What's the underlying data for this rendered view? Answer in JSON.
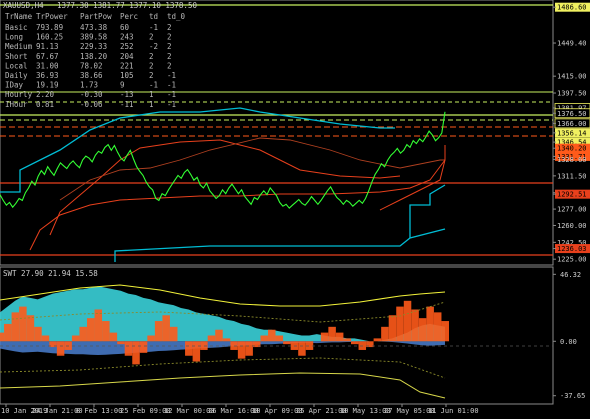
{
  "header": {
    "symbol": "XAUUSD,H4",
    "ohlc": "1377.30 1381.77 1377.10 1378.50"
  },
  "power_table": {
    "headers": [
      "TrName",
      "TrPower",
      "PartPow",
      "Perc",
      "td",
      "td_0"
    ],
    "rows": [
      [
        "Basic",
        "793.89",
        "473.38",
        "60",
        "-1",
        "2"
      ],
      [
        "Long",
        "160.25",
        "389.58",
        "243",
        "2",
        "2"
      ],
      [
        "Medium",
        "91.13",
        "229.33",
        "252",
        "-2",
        "2"
      ],
      [
        "Short",
        "67.67",
        "138.20",
        "204",
        "2",
        "2"
      ],
      [
        "Local",
        "31.00",
        "78.02",
        "221",
        "2",
        "2"
      ],
      [
        "Daily",
        "36.93",
        "38.66",
        "105",
        "2",
        "-1"
      ],
      [
        "IDay",
        "19.19",
        "1.73",
        "9",
        "-1",
        "-1"
      ],
      [
        "Hourly",
        "2.20",
        "-0.30",
        "-13",
        "1",
        "-1"
      ],
      [
        "IHour",
        "0.81",
        "-0.06",
        "-11",
        "1",
        "-1"
      ]
    ]
  },
  "indicator": {
    "label": "SWT 27.90 21.94 15.58",
    "axis_labels": [
      "46.32",
      "0.00",
      "-37.65"
    ]
  },
  "colors": {
    "background": "#000000",
    "price_line": "#33ff33",
    "trend_cyan": "#00bcd4",
    "trend_red": "#e8401c",
    "level_yellow": "#f0f060",
    "indicator_cyan": "#3ad0d8",
    "indicator_orange": "#ff5a1a",
    "indicator_blue": "#4a7fd0",
    "indicator_yellow": "#f2f23a"
  },
  "chart_data": [
    {
      "type": "line",
      "title": "XAUUSD,H4",
      "series": [
        {
          "values": [
            1292,
            1286,
            1281,
            1284,
            1279,
            1283,
            1288,
            1286,
            1294,
            1299,
            1306,
            1302,
            1311,
            1317,
            1313,
            1321,
            1316,
            1312,
            1319,
            1325,
            1322,
            1319,
            1324,
            1327,
            1323,
            1320,
            1328,
            1332,
            1330,
            1326,
            1333,
            1337,
            1335,
            1341,
            1344,
            1338,
            1343,
            1336,
            1330,
            1327,
            1333,
            1338,
            1329,
            1321,
            1316,
            1312,
            1305,
            1300,
            1297,
            1288,
            1286,
            1293,
            1291,
            1297,
            1302,
            1307,
            1312,
            1309,
            1315,
            1318,
            1313,
            1307,
            1310,
            1302,
            1299,
            1304,
            1296,
            1292,
            1288,
            1291,
            1297,
            1293,
            1299,
            1303,
            1298,
            1293,
            1297,
            1290,
            1286,
            1282,
            1289,
            1287,
            1292,
            1296,
            1292,
            1299,
            1295,
            1291,
            1284,
            1280,
            1282,
            1278,
            1281,
            1284,
            1287,
            1283,
            1281,
            1285,
            1290,
            1286,
            1282,
            1286,
            1291,
            1296,
            1300,
            1294,
            1289,
            1286,
            1282,
            1286,
            1284,
            1280,
            1283,
            1286,
            1283,
            1288,
            1296,
            1305,
            1313,
            1318,
            1324,
            1321,
            1328,
            1333,
            1336,
            1340,
            1335,
            1338,
            1344,
            1341,
            1348,
            1345,
            1350,
            1347,
            1352,
            1358,
            1354,
            1348,
            1351,
            1356,
            1378
          ]
        }
      ],
      "y_axis_labels": [
        "1486.60",
        "1449.40",
        "1415.00",
        "1397.50",
        "1381.97",
        "1376.50",
        "1366.00",
        "1356.14",
        "1346.54",
        "1340.20",
        "1331.71",
        "1328.60",
        "1311.50",
        "1294.00",
        "1292.51",
        "1277.00",
        "1260.00",
        "1242.50",
        "1236.03",
        "1225.00"
      ],
      "x_axis_labels": [
        "10 Jan 2019",
        "24 Jan 21:00",
        "8 Feb 13:00",
        "25 Feb 09:00",
        "12 Mar 00:00",
        "26 Mar 16:00",
        "10 Apr 09:00",
        "25 Apr 21:00",
        "10 May 13:00",
        "27 May 05:00",
        "11 Jun 01:00"
      ],
      "ylim": [
        1220,
        1492
      ]
    },
    {
      "type": "area",
      "title": "SWT 27.90 21.94 15.58",
      "ylim": [
        -42,
        50
      ],
      "y_axis_labels": [
        "46.32",
        "0.00",
        "-37.65"
      ],
      "series": [
        {
          "name": "cyan-envelope",
          "values": [
            20,
            24,
            28,
            31,
            30,
            29,
            31,
            33,
            34,
            35,
            36,
            36,
            37,
            38,
            37,
            36,
            35,
            33,
            32,
            30,
            29,
            27,
            26,
            25,
            23,
            22,
            20,
            19,
            18,
            17,
            15,
            14,
            12,
            11,
            9,
            8,
            8,
            7,
            6,
            5,
            4,
            4,
            5,
            4,
            3,
            3,
            2,
            2,
            1,
            0,
            0,
            1,
            2,
            4,
            6,
            9,
            11,
            12,
            11,
            10
          ]
        },
        {
          "name": "orange-oscillator",
          "values": [
            6,
            12,
            20,
            24,
            18,
            10,
            4,
            -4,
            -10,
            -6,
            4,
            10,
            16,
            22,
            14,
            6,
            -2,
            -10,
            -16,
            -8,
            4,
            14,
            18,
            10,
            0,
            -10,
            -14,
            -6,
            4,
            8,
            2,
            -6,
            -12,
            -10,
            -4,
            4,
            8,
            4,
            -2,
            -6,
            -10,
            -6,
            0,
            6,
            10,
            6,
            2,
            -2,
            -6,
            -4,
            2,
            10,
            18,
            24,
            28,
            22,
            16,
            24,
            20,
            14
          ]
        }
      ]
    }
  ]
}
